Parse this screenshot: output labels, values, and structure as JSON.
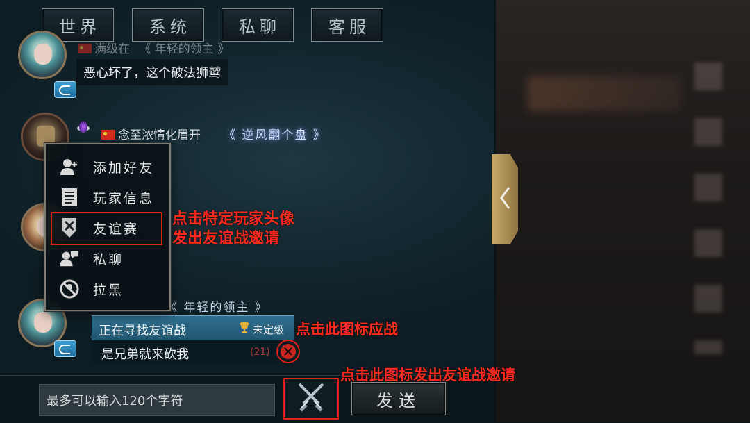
{
  "tabs": [
    "世界",
    "系统",
    "私聊",
    "客服"
  ],
  "messages": [
    {
      "name_partial": "满级在",
      "title_partial": "《 年轻的领主 》",
      "text": "恶心坏了，这个破法狮鹫"
    },
    {
      "name": "念至浓情化眉开",
      "title": "《 逆风翻个盘 》"
    },
    {
      "title_partial": "《 年轻的领主 》",
      "status_text": "正在寻找友谊战",
      "rank": "未定级",
      "text": "是兄弟就来砍我",
      "count": "(21)"
    }
  ],
  "context_menu": {
    "items": [
      {
        "label": "添加好友",
        "icon": "add-friend-icon"
      },
      {
        "label": "玩家信息",
        "icon": "player-info-icon"
      },
      {
        "label": "友谊赛",
        "icon": "friendly-match-icon"
      },
      {
        "label": "私聊",
        "icon": "private-chat-icon"
      },
      {
        "label": "拉黑",
        "icon": "block-icon"
      }
    ]
  },
  "annotations": {
    "avatar_tip_line1": "点击特定玩家头像",
    "avatar_tip_line2": "发出友谊战邀请",
    "accept_tip": "点击此图标应战",
    "invite_tip": "点击此图标发出友谊战邀请"
  },
  "input": {
    "placeholder": "最多可以输入120个字符"
  },
  "send_label": "发送",
  "colors": {
    "annotation_red": "#ff2a1e",
    "status_blue": "#2f6f8f",
    "gold_accent": "#c9ab6b"
  }
}
